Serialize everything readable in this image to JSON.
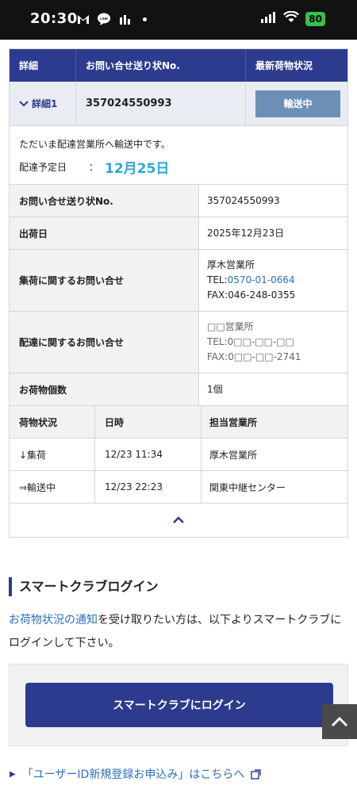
{
  "status_bar": {
    "time": "20:30",
    "battery": "80"
  },
  "table": {
    "headers": {
      "detail": "詳細",
      "tracking_no": "お問い合せ送り状No.",
      "latest_status": "最新荷物状況"
    },
    "detail_row": {
      "label": "詳細1",
      "tracking_no": "357024550993",
      "status_button": "輸送中"
    },
    "message": {
      "text": "ただいま配達営業所へ輸送中です。",
      "delivery_label": "配達予定日",
      "colon": "：",
      "delivery_date": "12月25日"
    },
    "info_rows": [
      {
        "key": "お問い合せ送り状No.",
        "lines": [
          "357024550993"
        ]
      },
      {
        "key": "出荷日",
        "lines": [
          "2025年12月23日"
        ]
      },
      {
        "key": "集荷に関するお問い合せ",
        "lines": [
          "厚木営業所",
          "TEL:",
          "0570-01-0664",
          "FAX:046-248-0355"
        ]
      },
      {
        "key": "配達に関するお問い合せ",
        "lines": [
          "□□営業所",
          "TEL:0□□-□□-□□",
          "FAX:0□□-□□-2741"
        ]
      },
      {
        "key": "お荷物個数",
        "lines": [
          "1個"
        ]
      }
    ],
    "history_headers": {
      "status": "荷物状況",
      "datetime": "日時",
      "office": "担当営業所"
    },
    "history": [
      {
        "status": "↓集荷",
        "datetime": "12/23 11:34",
        "office": "厚木営業所"
      },
      {
        "status": "⇒輸送中",
        "datetime": "12/23 22:23",
        "office": "関東中継センター"
      }
    ]
  },
  "smart_club": {
    "title": "スマートクラブログイン",
    "text_link": "お荷物状況の通知",
    "text_rest": "を受け取りたい方は、以下よりスマートクラブにログインして下さい。",
    "login_button": "スマートクラブにログイン",
    "register_link": "「ユーザーID新規登録お申込み」はこちらへ"
  },
  "colors": {
    "brand": "#2d3b8f",
    "status_button": "#6c8fb8",
    "date": "#2fa7d8",
    "link": "#2d6fc0"
  }
}
